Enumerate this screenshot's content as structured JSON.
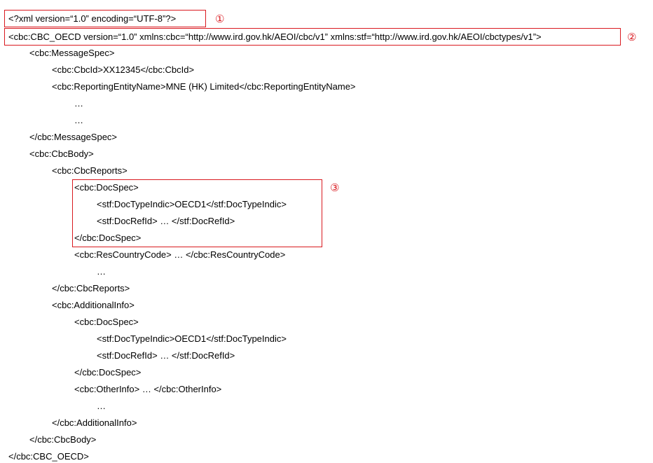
{
  "lines": [
    "<?xml version=“1.0” encoding=“UTF-8”?>",
    "<cbc:CBC_OECD version=“1.0” xmlns:cbc=“http://www.ird.gov.hk/AEOI/cbc/v1” xmlns:stf=“http://www.ird.gov.hk/AEOI/cbctypes/v1”>",
    "<cbc:MessageSpec>",
    "<cbc:CbcId>XX12345</cbc:CbcId>",
    "<cbc:ReportingEntityName>MNE (HK) Limited</cbc:ReportingEntityName>",
    "…",
    "…",
    "</cbc:MessageSpec>",
    "<cbc:CbcBody>",
    "<cbc:CbcReports>",
    "<cbc:DocSpec>",
    "<stf:DocTypeIndic>OECD1</stf:DocTypeIndic>",
    "<stf:DocRefId> … </stf:DocRefId>",
    "</cbc:DocSpec>",
    "<cbc:ResCountryCode> … </cbc:ResCountryCode>",
    "…",
    "</cbc:CbcReports>",
    "<cbc:AdditionalInfo>",
    "<cbc:DocSpec>",
    "<stf:DocTypeIndic>OECD1</stf:DocTypeIndic>",
    "<stf:DocRefId> … </stf:DocRefId>",
    "</cbc:DocSpec>",
    "<cbc:OtherInfo> … </cbc:OtherInfo>",
    "…",
    "</cbc:AdditionalInfo>",
    "</cbc:CbcBody>",
    "</cbc:CBC_OECD>"
  ],
  "markers": [
    "①",
    "②",
    "③"
  ],
  "colors": {
    "highlight": "#d9191f",
    "text": "#000000",
    "background": "#ffffff"
  }
}
